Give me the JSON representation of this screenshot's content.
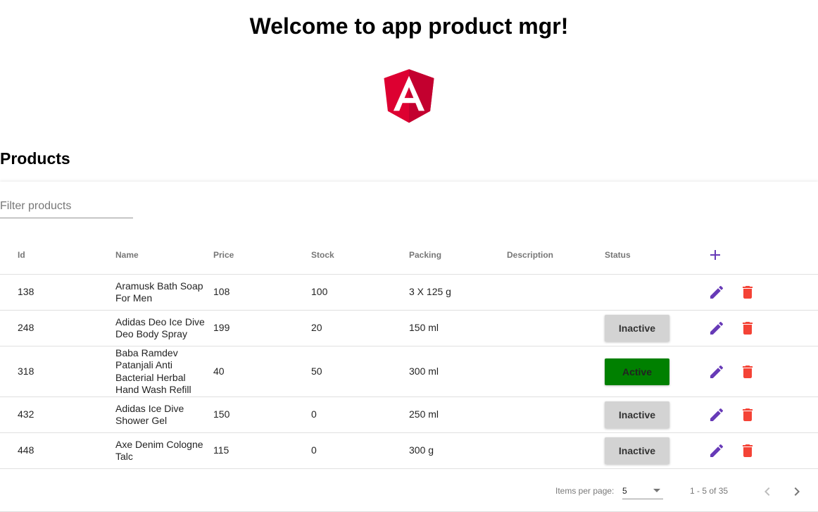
{
  "header": {
    "welcome": "Welcome to app product mgr!"
  },
  "section": {
    "title": "Products"
  },
  "filter": {
    "placeholder": "Filter products",
    "value": ""
  },
  "table": {
    "columns": {
      "id": "Id",
      "name": "Name",
      "price": "Price",
      "stock": "Stock",
      "packing": "Packing",
      "description": "Description",
      "status": "Status"
    },
    "rows": [
      {
        "id": "138",
        "name": "Aramusk Bath Soap For Men",
        "price": "108",
        "stock": "100",
        "packing": "3 X 125 g",
        "description": "",
        "status": ""
      },
      {
        "id": "248",
        "name": "Adidas Deo Ice Dive Deo Body Spray",
        "price": "199",
        "stock": "20",
        "packing": "150 ml",
        "description": "",
        "status": "Inactive"
      },
      {
        "id": "318",
        "name": "Baba Ramdev Patanjali Anti Bacterial Herbal Hand Wash Refill",
        "price": "40",
        "stock": "50",
        "packing": "300 ml",
        "description": "",
        "status": "Active"
      },
      {
        "id": "432",
        "name": "Adidas Ice Dive Shower Gel",
        "price": "150",
        "stock": "0",
        "packing": "250 ml",
        "description": "",
        "status": "Inactive"
      },
      {
        "id": "448",
        "name": "Axe Denim Cologne Talc",
        "price": "115",
        "stock": "0",
        "packing": "300 g",
        "description": "",
        "status": "Inactive"
      }
    ]
  },
  "icons": {
    "add": "plus-icon",
    "edit": "pencil-icon",
    "delete": "trash-icon",
    "prev": "chevron-left-icon",
    "next": "chevron-right-icon",
    "logo": "angular-logo"
  },
  "colors": {
    "edit_icon": "#673ab7",
    "delete_icon": "#f44336",
    "status_active": "#008000",
    "status_inactive": "#d3d3d3",
    "logo_red": "#dd0031",
    "logo_dark_red": "#c3002f"
  },
  "paginator": {
    "items_per_page_label": "Items per page:",
    "page_size": "5",
    "range_label": "1 - 5 of 35"
  }
}
